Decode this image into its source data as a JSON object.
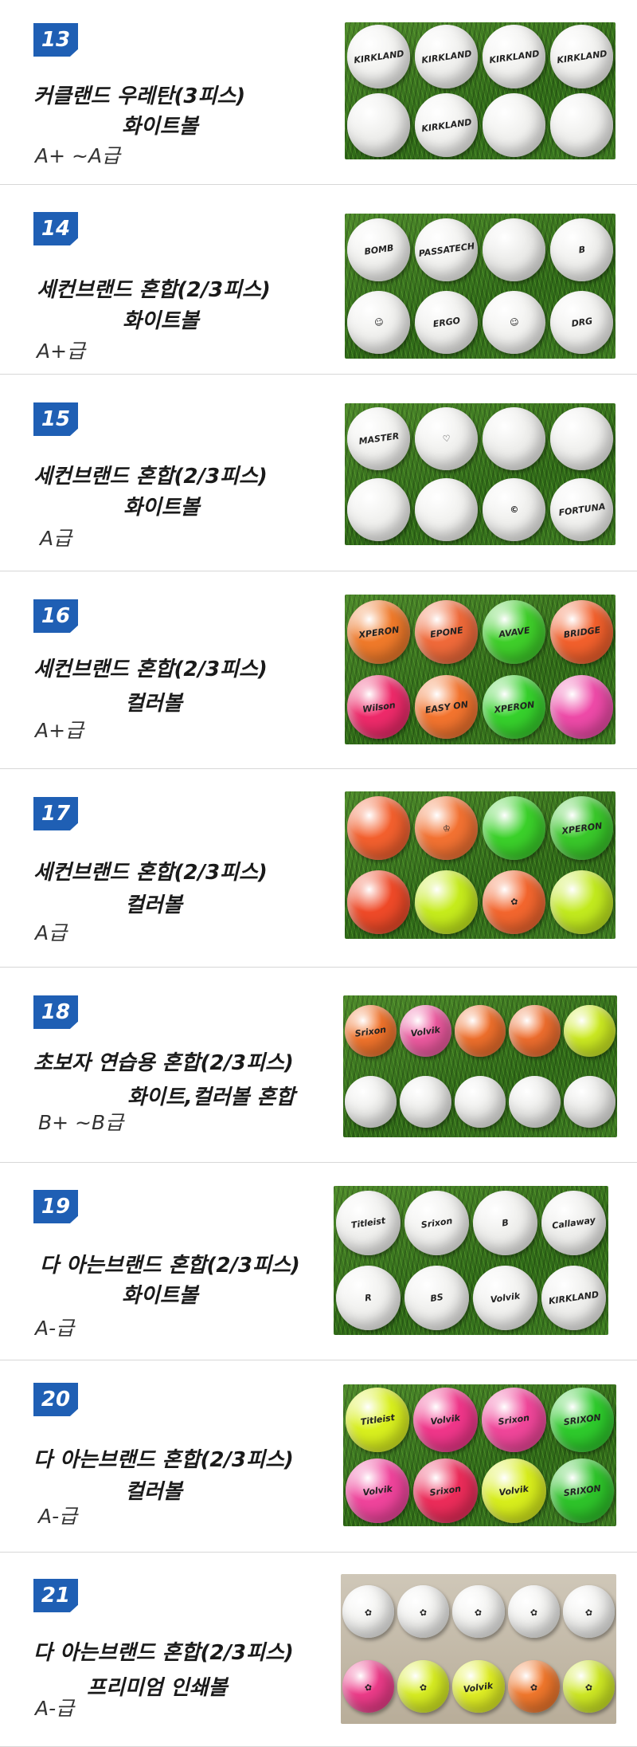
{
  "items": [
    {
      "number": "13",
      "title_line1": "커클랜드 우레탄(3피스)",
      "title_line2": "화이트볼",
      "grade": "A+ ~A급",
      "balls": [
        {
          "color": "#f4f4f2",
          "label": "KIRKLAND"
        },
        {
          "color": "#f1f1ef",
          "label": "KIRKLAND"
        },
        {
          "color": "#f3f3f1",
          "label": "KIRKLAND"
        },
        {
          "color": "#f2f2f0",
          "label": "KIRKLAND"
        },
        {
          "color": "#f0f0ee",
          "label": ""
        },
        {
          "color": "#f3f3f1",
          "label": "KIRKLAND"
        },
        {
          "color": "#f2f2f0",
          "label": ""
        },
        {
          "color": "#f1f1ef",
          "label": ""
        }
      ]
    },
    {
      "number": "14",
      "title_line1": "세컨브랜드 혼합(2/3피스)",
      "title_line2": "화이트볼",
      "grade": "A+급",
      "balls": [
        {
          "color": "#f2f2f0",
          "label": "BOMB"
        },
        {
          "color": "#f3f3f1",
          "label": "PASSATECH"
        },
        {
          "color": "#ededeb",
          "label": ""
        },
        {
          "color": "#f1f1ef",
          "label": "B"
        },
        {
          "color": "#f2f2f0",
          "label": "☺"
        },
        {
          "color": "#f1f1ef",
          "label": "ERGO"
        },
        {
          "color": "#f3f3f1",
          "label": "☺"
        },
        {
          "color": "#f2f2f0",
          "label": "DRG"
        }
      ]
    },
    {
      "number": "15",
      "title_line1": "세컨브랜드 혼합(2/3피스)",
      "title_line2": "화이트볼",
      "grade": "A급",
      "balls": [
        {
          "color": "#f3f3f1",
          "label": "MASTER"
        },
        {
          "color": "#f2f2f0",
          "label": "♡"
        },
        {
          "color": "#efefed",
          "label": ""
        },
        {
          "color": "#f1f1ef",
          "label": ""
        },
        {
          "color": "#f2f2f0",
          "label": ""
        },
        {
          "color": "#f3f3f1",
          "label": ""
        },
        {
          "color": "#f1f1ef",
          "label": "©"
        },
        {
          "color": "#f2f2f0",
          "label": "FORTUNA"
        }
      ]
    },
    {
      "number": "16",
      "title_line1": "세컨브랜드 혼합(2/3피스)",
      "title_line2": "컬러볼",
      "grade": "A+급",
      "balls": [
        {
          "color": "#f07a2a",
          "label": "XPERON"
        },
        {
          "color": "#f06a3a",
          "label": "EPONE"
        },
        {
          "color": "#3fcf2a",
          "label": "AVAVE"
        },
        {
          "color": "#f2602c",
          "label": "BRIDGE"
        },
        {
          "color": "#ee2a6a",
          "label": "Wilson"
        },
        {
          "color": "#f3742e",
          "label": "EASY ON"
        },
        {
          "color": "#36d12c",
          "label": "XPERON"
        },
        {
          "color": "#ee4aa8",
          "label": ""
        }
      ]
    },
    {
      "number": "17",
      "title_line1": "세컨브랜드 혼합(2/3피스)",
      "title_line2": "컬러볼",
      "grade": "A급",
      "balls": [
        {
          "color": "#f3602e",
          "label": ""
        },
        {
          "color": "#f37232",
          "label": "♔"
        },
        {
          "color": "#3bd12a",
          "label": ""
        },
        {
          "color": "#39c82a",
          "label": "XPERON"
        },
        {
          "color": "#ef4a28",
          "label": ""
        },
        {
          "color": "#c6ec1c",
          "label": ""
        },
        {
          "color": "#f3662e",
          "label": "✿"
        },
        {
          "color": "#c2ea1e",
          "label": ""
        }
      ]
    },
    {
      "number": "18",
      "title_line1": "초보자 연습용 혼합(2/3피스)",
      "title_line2": "화이트,컬러볼 혼합",
      "grade": "B+ ~B급",
      "balls": [
        {
          "color": "#f2742c",
          "label": "Srixon"
        },
        {
          "color": "#ee5aa0",
          "label": "Volvik"
        },
        {
          "color": "#f0702c",
          "label": ""
        },
        {
          "color": "#ef6e2e",
          "label": ""
        },
        {
          "color": "#cdeb22",
          "label": ""
        },
        {
          "color": "#efefed",
          "label": ""
        },
        {
          "color": "#ececea",
          "label": ""
        },
        {
          "color": "#eeeeec",
          "label": ""
        },
        {
          "color": "#ececea",
          "label": ""
        },
        {
          "color": "#e9e9e7",
          "label": ""
        }
      ]
    },
    {
      "number": "19",
      "title_line1": "다 아는브랜드 혼합(2/3피스)",
      "title_line2": "화이트볼",
      "grade": "A-급",
      "balls": [
        {
          "color": "#f1f1ef",
          "label": "Titleist"
        },
        {
          "color": "#f2f2f0",
          "label": "Srixon"
        },
        {
          "color": "#f0f0ee",
          "label": "B"
        },
        {
          "color": "#efefed",
          "label": "Callaway"
        },
        {
          "color": "#f2f2f0",
          "label": "R"
        },
        {
          "color": "#f1f1ef",
          "label": "BS"
        },
        {
          "color": "#f2f2f0",
          "label": "Volvik"
        },
        {
          "color": "#efefed",
          "label": "KIRKLAND"
        }
      ]
    },
    {
      "number": "20",
      "title_line1": "다 아는브랜드 혼합(2/3피스)",
      "title_line2": "컬러볼",
      "grade": "A-급",
      "balls": [
        {
          "color": "#d9f01e",
          "label": "Titleist"
        },
        {
          "color": "#f0368a",
          "label": "Volvik"
        },
        {
          "color": "#f0469a",
          "label": "Srixon"
        },
        {
          "color": "#2ecb2c",
          "label": "SRIXON"
        },
        {
          "color": "#f0449c",
          "label": "Volvik"
        },
        {
          "color": "#ec2c5a",
          "label": "Srixon"
        },
        {
          "color": "#d8ee1c",
          "label": "Volvik"
        },
        {
          "color": "#2ec42a",
          "label": "SRIXON"
        }
      ]
    },
    {
      "number": "21",
      "title_line1": "다 아는브랜드 혼합(2/3피스)",
      "title_line2": "프리미엄 인쇄볼",
      "grade": "A-급",
      "balls": [
        {
          "color": "#f4f4f2",
          "label": "✿"
        },
        {
          "color": "#f3f3f1",
          "label": "✿"
        },
        {
          "color": "#f4f4f2",
          "label": "✿"
        },
        {
          "color": "#f3f3f1",
          "label": "✿"
        },
        {
          "color": "#f2f2f0",
          "label": "✿"
        },
        {
          "color": "#ee3c8a",
          "label": "✿"
        },
        {
          "color": "#d8ee22",
          "label": "✿"
        },
        {
          "color": "#e0ef24",
          "label": "Volvik"
        },
        {
          "color": "#f2782c",
          "label": "✿"
        },
        {
          "color": "#cfe924",
          "label": "✿"
        }
      ]
    }
  ]
}
